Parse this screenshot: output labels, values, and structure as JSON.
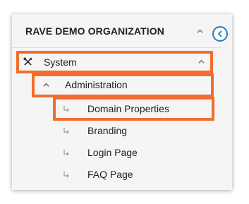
{
  "org": {
    "title": "RAVE DEMO ORGANIZATION"
  },
  "nav": {
    "system": {
      "label": "System",
      "icon": "tools-icon"
    },
    "administration": {
      "label": "Administration"
    },
    "items": [
      {
        "label": "Domain Properties"
      },
      {
        "label": "Branding"
      },
      {
        "label": "Login Page"
      },
      {
        "label": "FAQ Page"
      }
    ]
  },
  "colors": {
    "highlight": "#f26d2c",
    "accent": "#1f7cc1",
    "panel_bg": "#f5f5f5",
    "text": "#222222"
  }
}
